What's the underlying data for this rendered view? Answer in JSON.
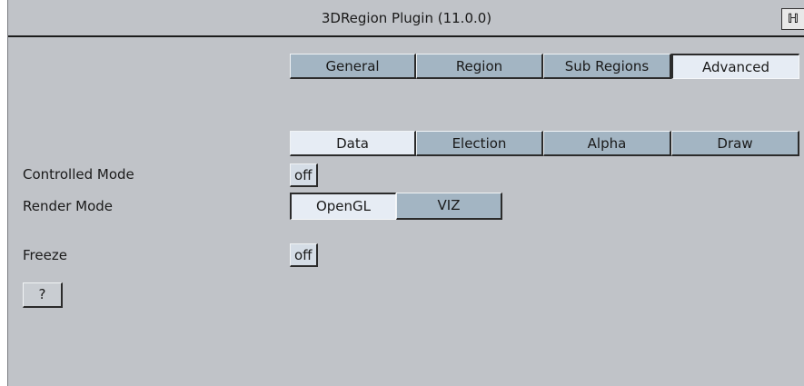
{
  "window": {
    "title": "3DRegion Plugin (11.0.0)",
    "corner_icon": "help-context-icon",
    "corner_glyph": "ℍ"
  },
  "main_tabs": [
    {
      "label": "General",
      "active": false
    },
    {
      "label": "Region",
      "active": false
    },
    {
      "label": "Sub Regions",
      "active": false
    },
    {
      "label": "Advanced",
      "active": true
    }
  ],
  "sub_tabs": [
    {
      "label": "Data",
      "active": true
    },
    {
      "label": "Election",
      "active": false
    },
    {
      "label": "Alpha",
      "active": false
    },
    {
      "label": "Draw",
      "active": false
    }
  ],
  "controlled_mode": {
    "label": "Controlled Mode",
    "value": "off"
  },
  "render_mode": {
    "label": "Render Mode",
    "options": [
      {
        "label": "OpenGL",
        "selected": true
      },
      {
        "label": "VIZ",
        "selected": false
      }
    ]
  },
  "freeze": {
    "label": "Freeze",
    "value": "off"
  },
  "help_button": {
    "label": "?"
  }
}
